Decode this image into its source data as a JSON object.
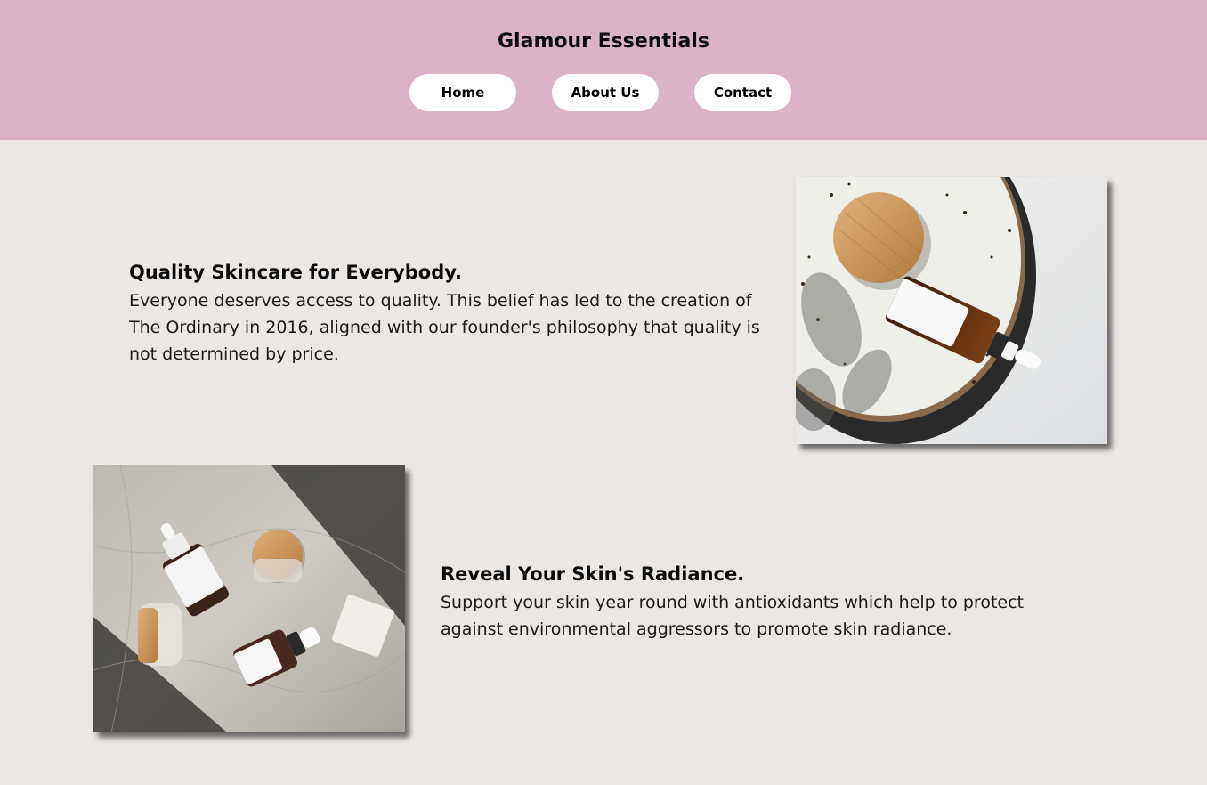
{
  "header": {
    "title": "Glamour Essentials",
    "nav": [
      {
        "label": "Home"
      },
      {
        "label": "About Us"
      },
      {
        "label": "Contact"
      }
    ]
  },
  "sections": [
    {
      "title": "Quality Skincare for Everybody.",
      "text": "Everyone deserves access to quality. This belief has led to the creation of The Ordinary in 2016, aligned with our founder's philosophy that quality is not determined by price."
    },
    {
      "title": "Reveal Your Skin's Radiance.",
      "text": "Support your skin year round with antioxidants which help to protect against environmental aggressors to promote skin radiance."
    }
  ],
  "colors": {
    "header_bg": "#dbb2c6",
    "page_bg": "#ebe7e4",
    "nav_bg": "#ffffff"
  }
}
